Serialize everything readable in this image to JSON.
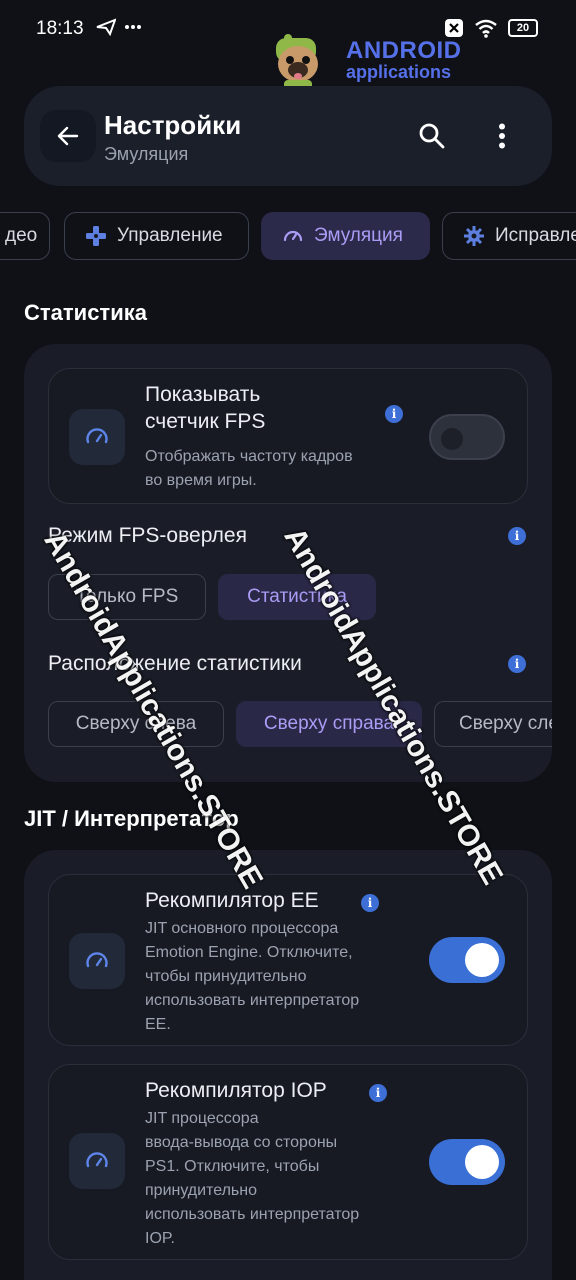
{
  "status": {
    "time": "18:13",
    "battery": "20"
  },
  "logo": {
    "title": "ANDROID",
    "subtitle": "applications"
  },
  "appbar": {
    "title": "Настройки",
    "subtitle": "Эмуляция"
  },
  "tabs": [
    {
      "label": "део",
      "icon": "none"
    },
    {
      "label": "Управление",
      "icon": "gamepad-icon"
    },
    {
      "label": "Эмуляция",
      "icon": "speedometer-icon"
    },
    {
      "label": "Исправле",
      "icon": "gear-icon"
    }
  ],
  "sections": {
    "stats": {
      "title": "Статистика",
      "fps_item": {
        "title_line1": "Показывать",
        "title_line2": "счетчик FPS",
        "desc_line1": "Отображать частоту кадров",
        "desc_line2": "во время игры.",
        "enabled": false
      },
      "overlay_mode": {
        "label": "Режим FPS-оверлея",
        "options": [
          "Только FPS",
          "Статистика"
        ],
        "selected": "Статистика"
      },
      "position": {
        "label": "Расположение статистики",
        "options": [
          "Сверху слева",
          "Сверху справа",
          "Сверху сле"
        ],
        "selected": "Сверху справа"
      }
    },
    "jit": {
      "title": "JIT / Интерпретатор",
      "ee": {
        "title": "Рекомпилятор EE",
        "desc": [
          "JIT основного процессора",
          "Emotion Engine. Отключите,",
          "чтобы принудительно",
          "использовать интерпретатор",
          "EE."
        ],
        "enabled": true
      },
      "iop": {
        "title": "Рекомпилятор IOP",
        "desc": [
          "JIT процессора",
          "ввода-вывода со стороны",
          "PS1. Отключите, чтобы",
          "принудительно",
          "использовать интерпретатор",
          "IOP."
        ],
        "enabled": true
      }
    }
  },
  "watermarks": [
    "AndroidApplications.STORE",
    "AndroidApplications.STORE"
  ],
  "colors": {
    "accent": "#a99cf5",
    "switch_on": "#3a6fd6",
    "background": "#0f1117",
    "card": "#1a1d27"
  }
}
